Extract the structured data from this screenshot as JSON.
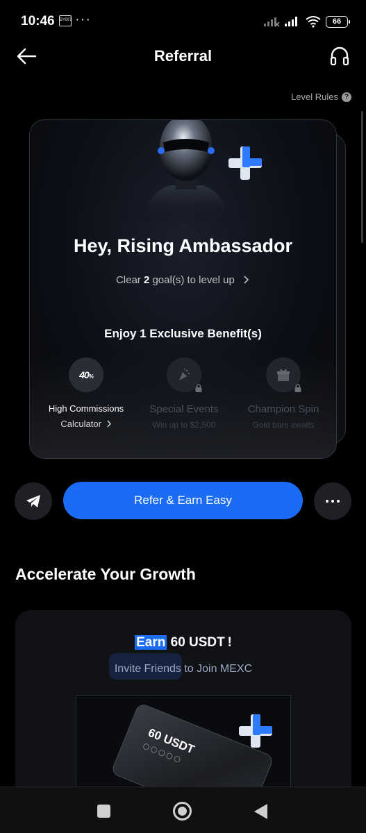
{
  "status_bar": {
    "time": "10:46",
    "app_icon_label": "BYBIT",
    "overflow": "···",
    "battery": "66"
  },
  "header": {
    "title": "Referral",
    "level_rules": "Level Rules",
    "help_glyph": "?"
  },
  "hero": {
    "title": "Hey, Rising Ambassador",
    "level_prefix": "Clear ",
    "goal_count": "2",
    "level_suffix": " goal(s) to level up",
    "benefit_heading": "Enjoy 1 Exclusive Benefit(s)"
  },
  "benefits": [
    {
      "badge": "40",
      "badge_unit": "%",
      "name": "High Commissions",
      "sub": "Calculator",
      "locked": false,
      "icon": "commission-badge-icon"
    },
    {
      "name": "Special Events",
      "sub": "Win up to $2,500",
      "locked": true,
      "icon": "party-popper-icon"
    },
    {
      "name": "Champion Spin",
      "sub": "Gold bars awaits",
      "locked": true,
      "icon": "gift-box-icon"
    }
  ],
  "actions": {
    "refer_label": "Refer & Earn Easy",
    "share_icon": "telegram-icon",
    "more_icon": "more-dots-icon"
  },
  "section": {
    "title": "Accelerate Your Growth"
  },
  "promo": {
    "title_highlight": "Earn",
    "title_rest": " 60 USDT !",
    "subtitle": "Invite Friends to Join MEXC",
    "voucher_text": "60 USDT"
  },
  "colors": {
    "accent": "#1a6cf5",
    "background": "#000000",
    "card": "#101216"
  }
}
